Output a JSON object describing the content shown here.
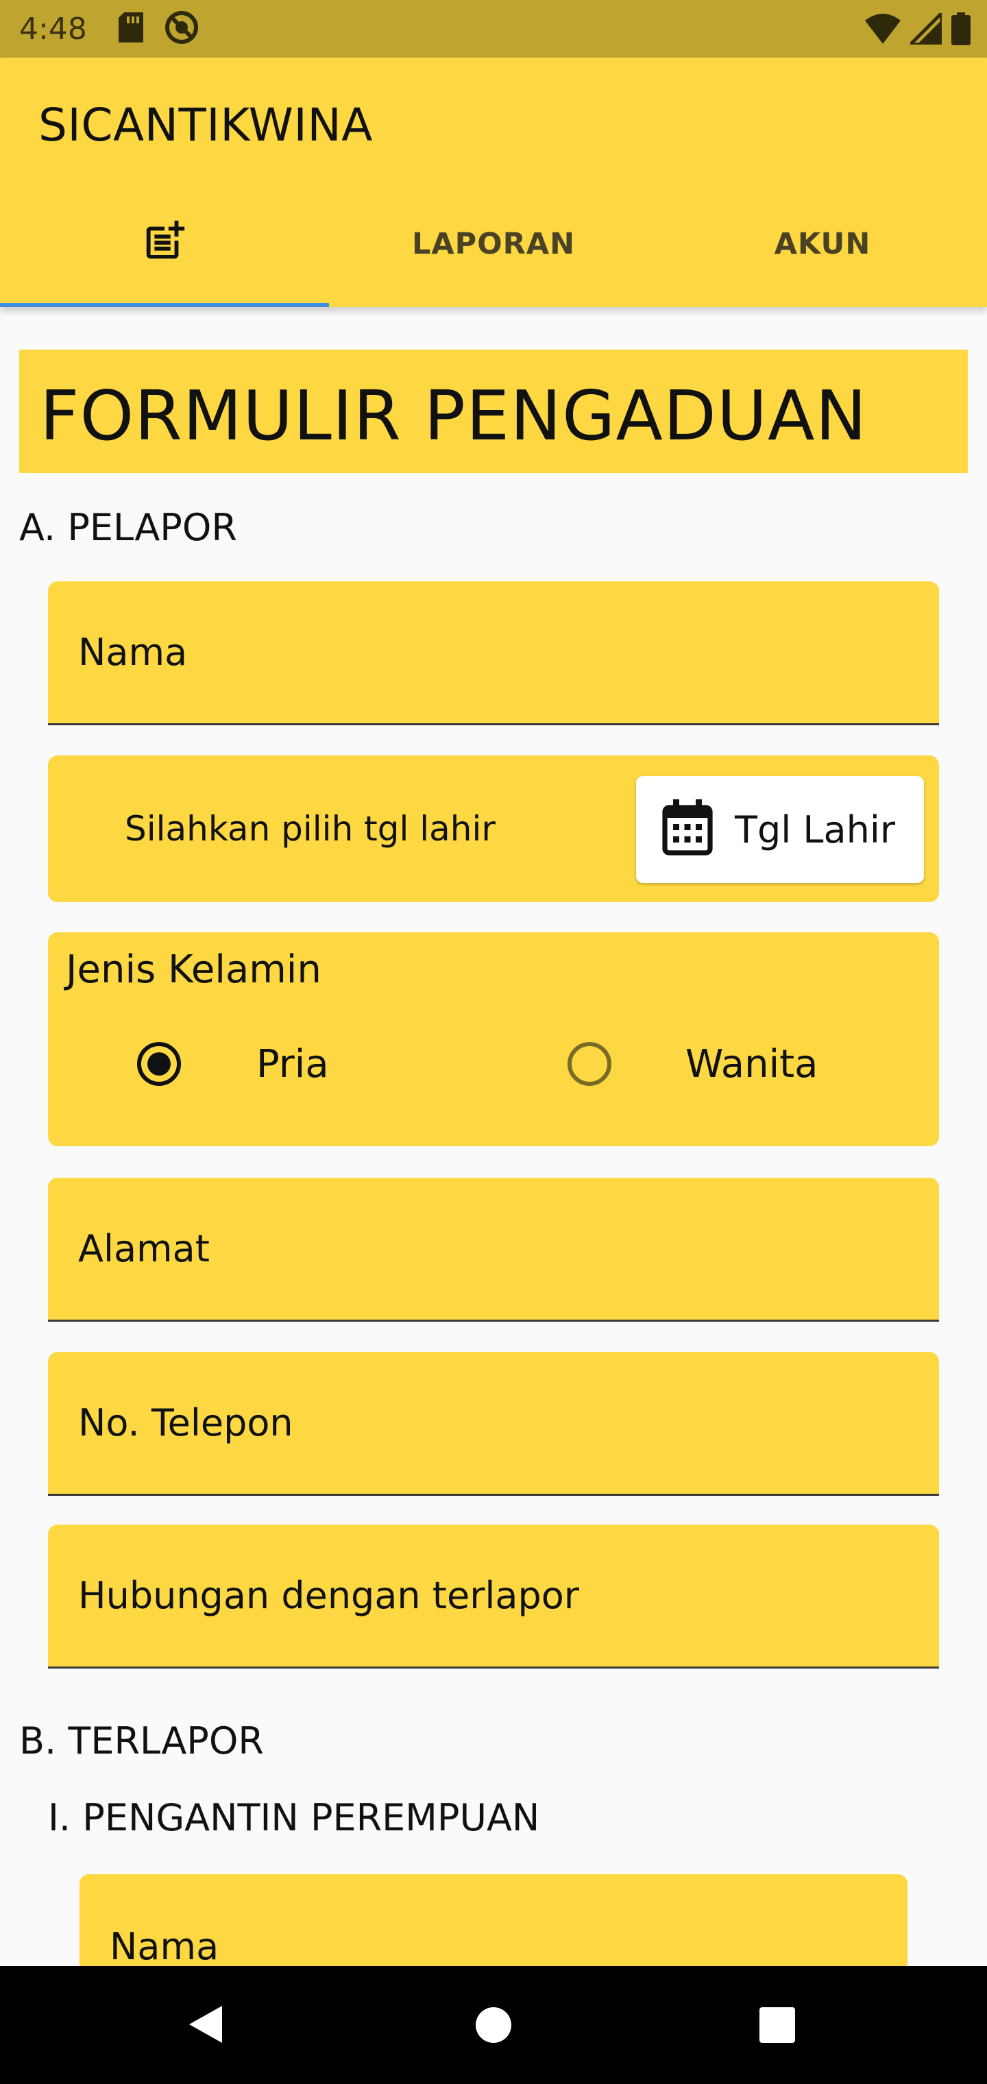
{
  "status_bar": {
    "time": "4:48",
    "icons_left": [
      "sd-card-icon",
      "do-not-disturb-icon"
    ],
    "icons_right": [
      "wifi-icon",
      "signal-icon",
      "battery-icon"
    ]
  },
  "app": {
    "title": "SICANTIKWINA",
    "tabs": [
      {
        "label": "",
        "icon": "post-add-icon",
        "selected": true
      },
      {
        "label": "LAPORAN",
        "selected": false
      },
      {
        "label": "AKUN",
        "selected": false
      }
    ],
    "accent_color": "#FDD843",
    "indicator_color": "#3D8FE0"
  },
  "form": {
    "title": "FORMULIR PENGADUAN",
    "section_a": {
      "label": "A. PELAPOR",
      "nama_label": "Nama",
      "date_hint": "Silahkan pilih tgl lahir",
      "date_button": "Tgl Lahir",
      "gender": {
        "label": "Jenis Kelamin",
        "options": [
          "Pria",
          "Wanita"
        ],
        "selected": "Pria"
      },
      "alamat_label": "Alamat",
      "telepon_label": "No. Telepon",
      "hubungan_label": "Hubungan dengan terlapor"
    },
    "section_b": {
      "label": "B. TERLAPOR",
      "subsection_label": "I. PENGANTIN PEREMPUAN",
      "nama_label": "Nama"
    }
  },
  "nav": {
    "buttons": [
      "back-icon",
      "home-icon",
      "recents-icon"
    ]
  }
}
